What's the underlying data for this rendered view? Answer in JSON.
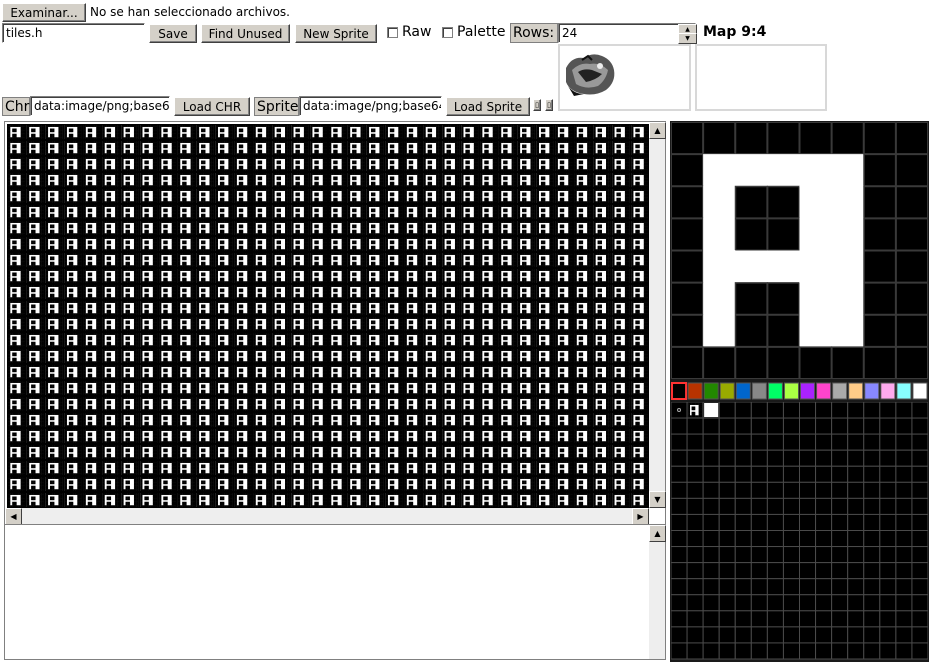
{
  "file_chooser": {
    "button": "Examinar...",
    "status": "No se han seleccionado archivos."
  },
  "toolbar": {
    "filename": "tiles.h",
    "save": "Save",
    "find_unused": "Find Unused",
    "new_sprite": "New Sprite",
    "raw": "Raw",
    "palette": "Palette",
    "rows_label": "Rows:",
    "rows_value": "24",
    "map_label": "Map 9:4"
  },
  "loaders": {
    "chr_label": "Chr",
    "chr_value": "data:image/png;base64",
    "load_chr": "Load CHR",
    "sprite_label": "Sprite",
    "sprite_value": "data:image/png;base64",
    "load_sprite": "Load Sprite"
  },
  "tile_grid": {
    "glyph": "A",
    "columns": 34,
    "rows": 24
  },
  "palette": {
    "colors": [
      "#000000",
      "#b83300",
      "#228800",
      "#99aa00",
      "#0066cc",
      "#888888",
      "#00ff66",
      "#aaff44",
      "#aa22ff",
      "#ff44cc",
      "#aaaaaa",
      "#ffcc88",
      "#8888ff",
      "#ffaaee",
      "#88ffff",
      "#ffffff"
    ]
  },
  "editor": {
    "pixels": [
      "11111111",
      "10000011",
      "10110011",
      "10110011",
      "10000011",
      "10110011",
      "10110011",
      "11111111"
    ]
  }
}
